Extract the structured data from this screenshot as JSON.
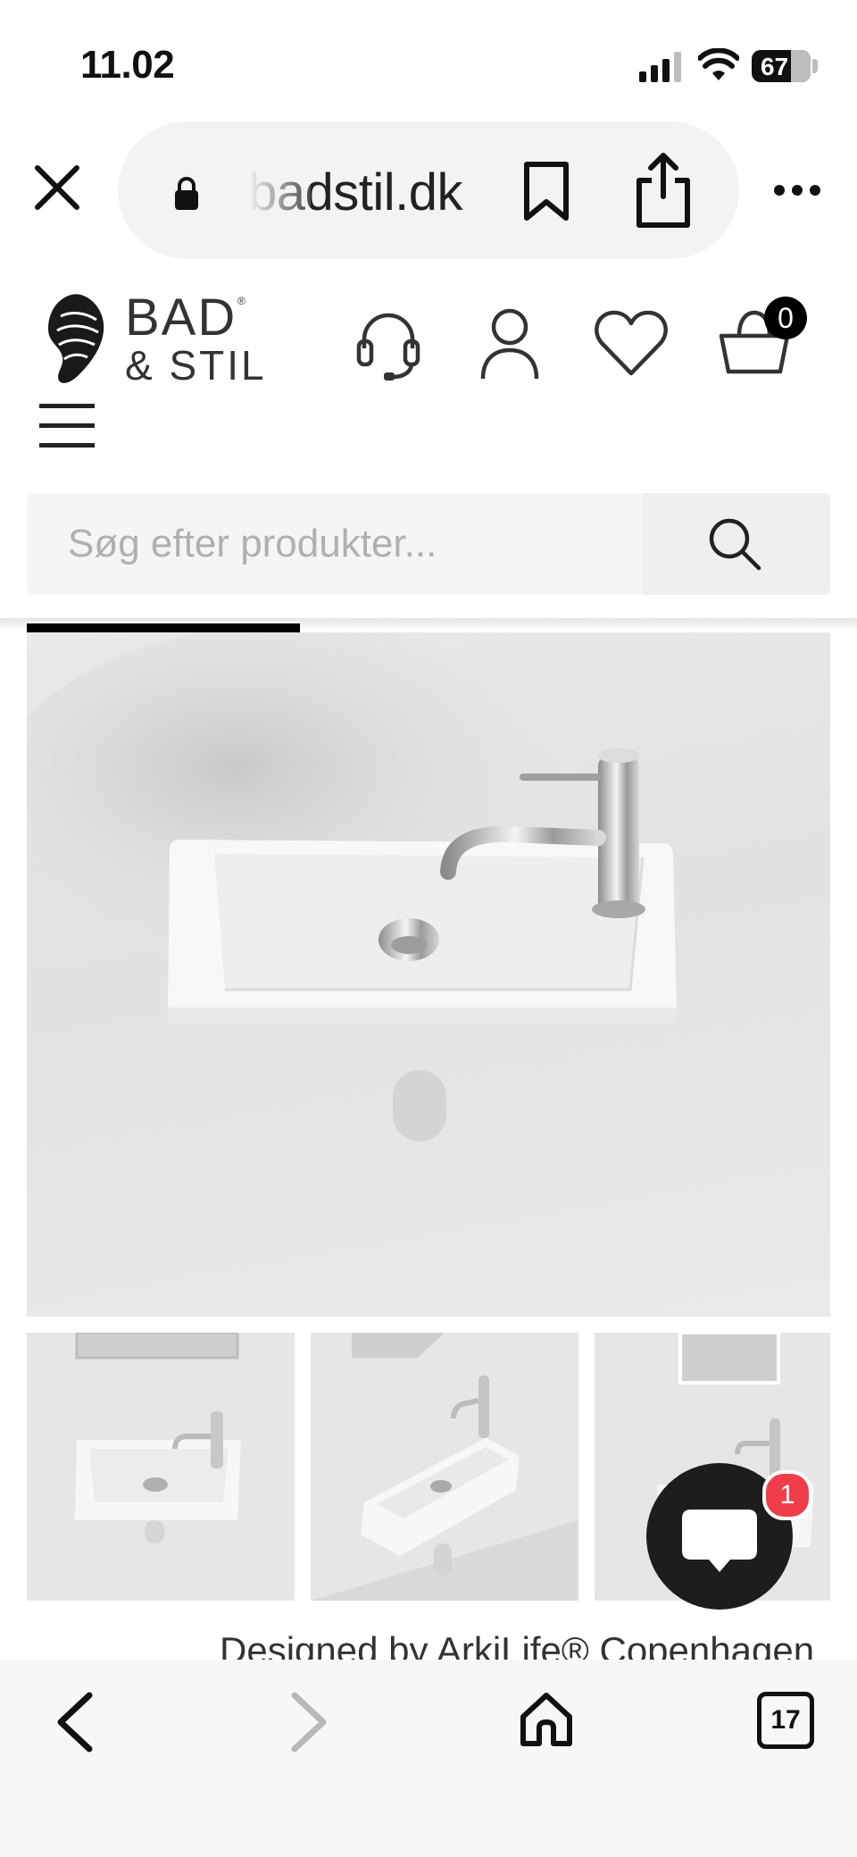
{
  "status_bar": {
    "time": "11.02",
    "battery": "67"
  },
  "browser": {
    "url": "badstil.dk",
    "icons": [
      "close-icon",
      "lock-icon",
      "bookmark-icon",
      "share-icon",
      "more-icon"
    ]
  },
  "site_header": {
    "logo_line1": "BAD",
    "logo_reg": "®",
    "logo_line2": "& STIL",
    "icons": [
      "headset-icon",
      "user-icon",
      "heart-icon",
      "basket-icon",
      "menu-icon"
    ],
    "cart_count": "0"
  },
  "search": {
    "placeholder": "Søg efter produkter..."
  },
  "product": {
    "gallery_progress": 0.34,
    "thumbnails": 3,
    "designed_by": "Designed by ArkiLife® Copenhagen"
  },
  "chat": {
    "badge_count": "1"
  },
  "bottom_toolbar": {
    "icons": [
      "back-icon",
      "forward-icon",
      "home-icon",
      "tabs-icon"
    ],
    "tabs_count": "17"
  }
}
